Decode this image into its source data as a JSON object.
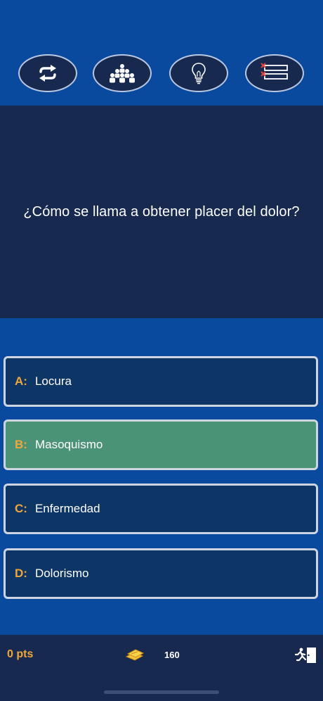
{
  "lifelines": [
    {
      "name": "swap-question",
      "icon": "swap-arrows-icon"
    },
    {
      "name": "ask-audience",
      "icon": "audience-icon"
    },
    {
      "name": "hint",
      "icon": "lightbulb-icon"
    },
    {
      "name": "fifty-fifty",
      "icon": "remove-answers-icon"
    }
  ],
  "question": {
    "text": "¿Cómo se llama a obtener placer del dolor?"
  },
  "answers": [
    {
      "letter": "A:",
      "text": "Locura",
      "selected": false
    },
    {
      "letter": "B:",
      "text": "Masoquismo",
      "selected": true
    },
    {
      "letter": "C:",
      "text": "Enfermedad",
      "selected": false
    },
    {
      "letter": "D:",
      "text": "Dolorismo",
      "selected": false
    }
  ],
  "footer": {
    "points": "0 pts",
    "coins": "160"
  },
  "colors": {
    "background": "#0a4a9e",
    "panel": "#17294f",
    "answer": "#0d3566",
    "selected_answer": "#4a9376",
    "accent": "#f1a63a"
  }
}
